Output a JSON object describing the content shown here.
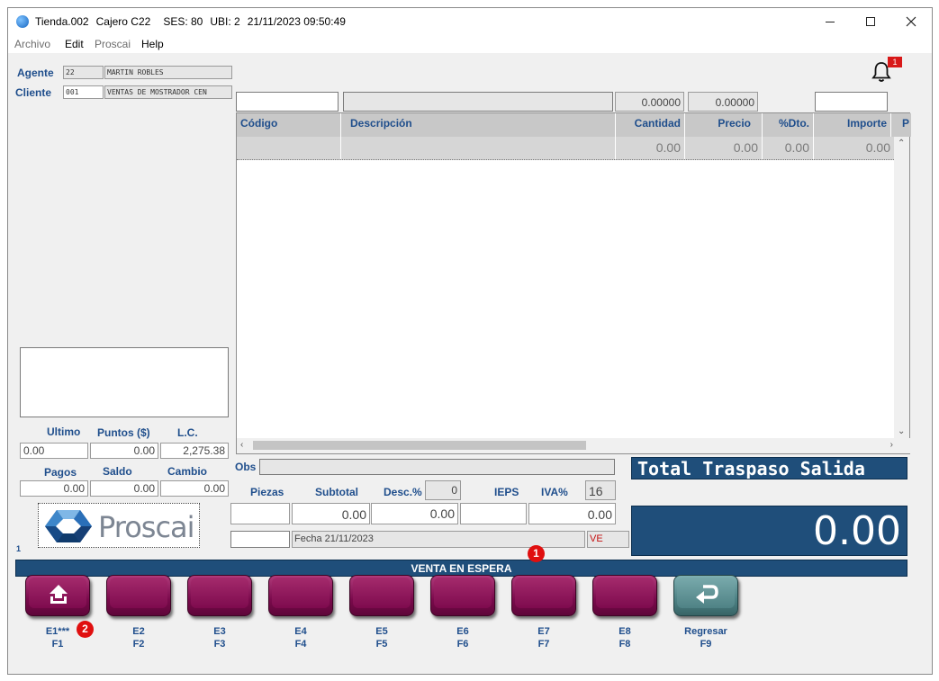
{
  "titlebar": {
    "store": "Tienda.002",
    "cashier": "Cajero C22",
    "session": "SES: 80",
    "location": "UBI: 2",
    "datetime": "21/11/2023 09:50:49"
  },
  "menu": [
    "Archivo",
    "Edit",
    "Proscai",
    "Help"
  ],
  "notifications": {
    "count": "1"
  },
  "left": {
    "agente_label": "Agente",
    "agente_code": "22",
    "agente_name": "MARTIN ROBLES",
    "cliente_label": "Cliente",
    "cliente_code": "001",
    "cliente_name": "VENTAS DE MOSTRADOR CEN",
    "ultimo_label": "Ultimo",
    "puntos_label": "Puntos ($)",
    "lc_label": "L.C.",
    "ultimo_value": "0.00",
    "puntos_value": "0.00",
    "lc_value": "2,275.38",
    "pagos_label": "Pagos",
    "saldo_label": "Saldo",
    "cambio_label": "Cambio",
    "pagos_value": "0.00",
    "saldo_value": "0.00",
    "cambio_value": "0.00",
    "page_number": "1",
    "logo_text": "Proscai"
  },
  "entry": {
    "codigo": "",
    "descripcion": "",
    "cantidad": "0.00000",
    "precio": "0.00000",
    "extra": ""
  },
  "grid": {
    "headers": {
      "codigo": "Código",
      "descripcion": "Descripción",
      "cantidad": "Cantidad",
      "precio": "Precio",
      "dto": "%Dto.",
      "importe": "Importe",
      "p": "P"
    },
    "row": {
      "cantidad": "0.00",
      "precio": "0.00",
      "dto": "0.00",
      "importe": "0.00"
    }
  },
  "totals": {
    "obs_label": "Obs",
    "piezas_label": "Piezas",
    "subtotal_label": "Subtotal",
    "desc_label": "Desc.%",
    "desc_value": "0",
    "ieps_label": "IEPS",
    "iva_label": "IVA%",
    "iva_value": "16",
    "piezas_value": "",
    "subtotal_value": "0.00",
    "desc_amount": "0.00",
    "ieps_value": "",
    "iva_amount": "0.00",
    "fecha": "Fecha 21/11/2023",
    "doc_type": "VE",
    "total_title": "Total Traspaso Salida",
    "total_value": "0.00"
  },
  "status": {
    "text": "VENTA EN ESPERA",
    "marker_1": "1",
    "marker_2": "2"
  },
  "function_keys": [
    {
      "label": "E1***",
      "key": "F1",
      "icon": "upload-icon"
    },
    {
      "label": "E2",
      "key": "F2"
    },
    {
      "label": "E3",
      "key": "F3"
    },
    {
      "label": "E4",
      "key": "F4"
    },
    {
      "label": "E5",
      "key": "F5"
    },
    {
      "label": "E6",
      "key": "F6"
    },
    {
      "label": "E7",
      "key": "F7"
    },
    {
      "label": "E8",
      "key": "F8"
    },
    {
      "label": "Regresar",
      "key": "F9",
      "icon": "return-icon"
    }
  ],
  "colors": {
    "panel_blue": "#1f4e7a",
    "label_blue": "#1f4e8c",
    "key_magenta": "#7a0a4c",
    "key_teal": "#4d8184",
    "badge_red": "#e00f0f"
  }
}
